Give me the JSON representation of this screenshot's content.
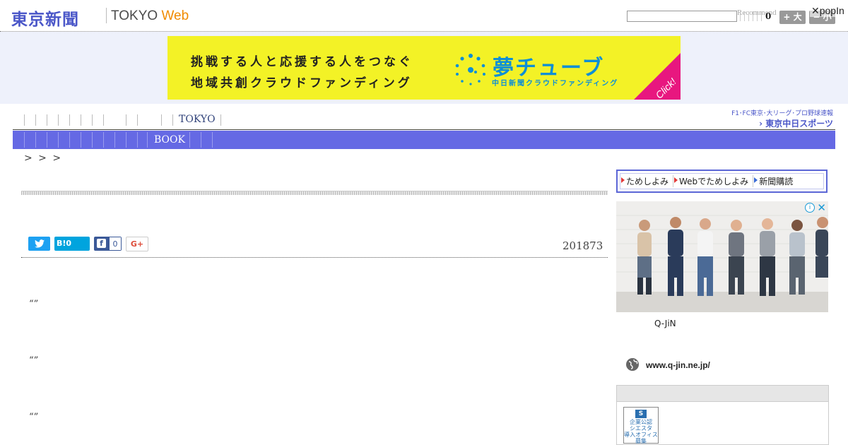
{
  "header": {
    "logo_jp": "東京新聞",
    "logo_en": "TOKYO",
    "logo_web": "Web",
    "recommend_label": "Recommend",
    "count": "0",
    "size_up_label": "+ 大",
    "size_down_label": "− 小",
    "popin": "✕popIn"
  },
  "banner": {
    "line1": "挑戦する人と応援する人をつなぐ",
    "line2": "地域共創クラウドファンディング",
    "brand": "夢チューブ",
    "brand_sub": "中日新聞クラウドファンディング",
    "click": "Click!",
    "colors": {
      "background": "#f3f226",
      "brand": "#0d8fd6",
      "corner": "#e8177f"
    }
  },
  "nav": {
    "tokyo_label": "TOKYO",
    "book_label": "BOOK",
    "sports_line1": "F1･FC東京･大リーグ･プロ野球速報",
    "sports_line2": "› 東京中日スポーツ",
    "bar_color": "#6569e4"
  },
  "breadcrumb": "> > >",
  "article": {
    "date": "201873",
    "quotes": [
      "“”",
      "“”",
      "“”"
    ],
    "share": {
      "twitter_icon": "twitter-bird",
      "hatena_label": "B!0",
      "facebook_icon": "f",
      "facebook_count": "0",
      "googleplus_label": "G+"
    }
  },
  "sidebar": {
    "trial_items": [
      "ためしよみ",
      "Webでためしよみ",
      "新聞購読"
    ],
    "ad": {
      "source": "Q-JiN",
      "url": "www.q-jin.ne.jp/"
    },
    "office_badge": "企業公認\nシエスタ\n導入オフィス\n募集"
  }
}
